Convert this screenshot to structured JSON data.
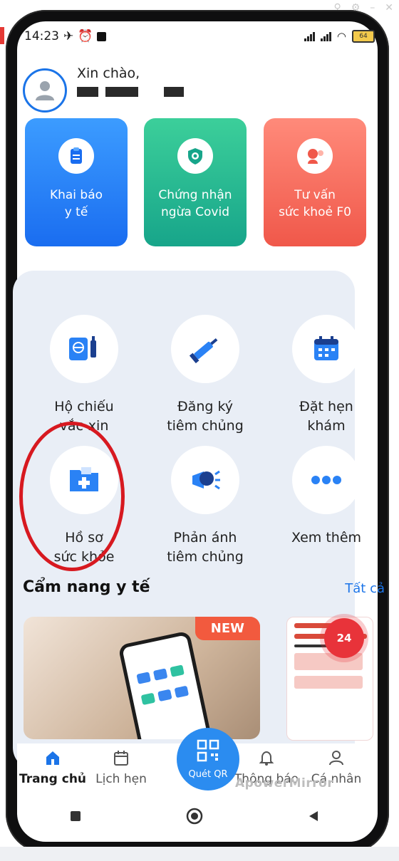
{
  "status_bar": {
    "time": "14:23",
    "battery": "64"
  },
  "greeting": {
    "hello": "Xin chào,"
  },
  "quick_cards": [
    {
      "label": "Khai báo\ny tế",
      "icon": "clipboard-icon"
    },
    {
      "label": "Chứng nhận\nngừa Covid",
      "icon": "shield-virus-icon"
    },
    {
      "label": "Tư vấn\nsức khoẻ F0",
      "icon": "doctor-chat-icon"
    }
  ],
  "services": [
    {
      "label": "Hộ chiếu\nvắc-xin",
      "icon": "vaccine-passport-icon"
    },
    {
      "label": "Đăng ký\ntiêm chủng",
      "icon": "syringe-icon"
    },
    {
      "label": "Đặt hẹn\nkhám",
      "icon": "calendar-icon"
    },
    {
      "label": "Hồ sơ\nsức khỏe",
      "icon": "health-record-folder-icon"
    },
    {
      "label": "Phản ánh\ntiêm chủng",
      "icon": "megaphone-icon"
    },
    {
      "label": "Xem thêm",
      "icon": "more-dots-icon"
    }
  ],
  "handbook": {
    "title": "Cẩm nang y tế",
    "see_all": "Tất cả",
    "new_badge": "NEW",
    "hotline": "24"
  },
  "bottom_nav": [
    {
      "label": "Trang chủ",
      "icon": "home-icon"
    },
    {
      "label": "Lịch hẹn",
      "icon": "calendar-outline-icon"
    },
    {
      "label": "Quét QR",
      "icon": "qr-scan-icon"
    },
    {
      "label": "Thông báo",
      "icon": "bell-icon"
    },
    {
      "label": "Cá nhân",
      "icon": "user-icon"
    }
  ],
  "watermark": "ApowerMirror",
  "colors": {
    "primary": "#1b74e8",
    "card_blue": "#2a82f5",
    "card_green": "#22b890",
    "card_red": "#f46a5c",
    "highlight": "#d71920"
  }
}
